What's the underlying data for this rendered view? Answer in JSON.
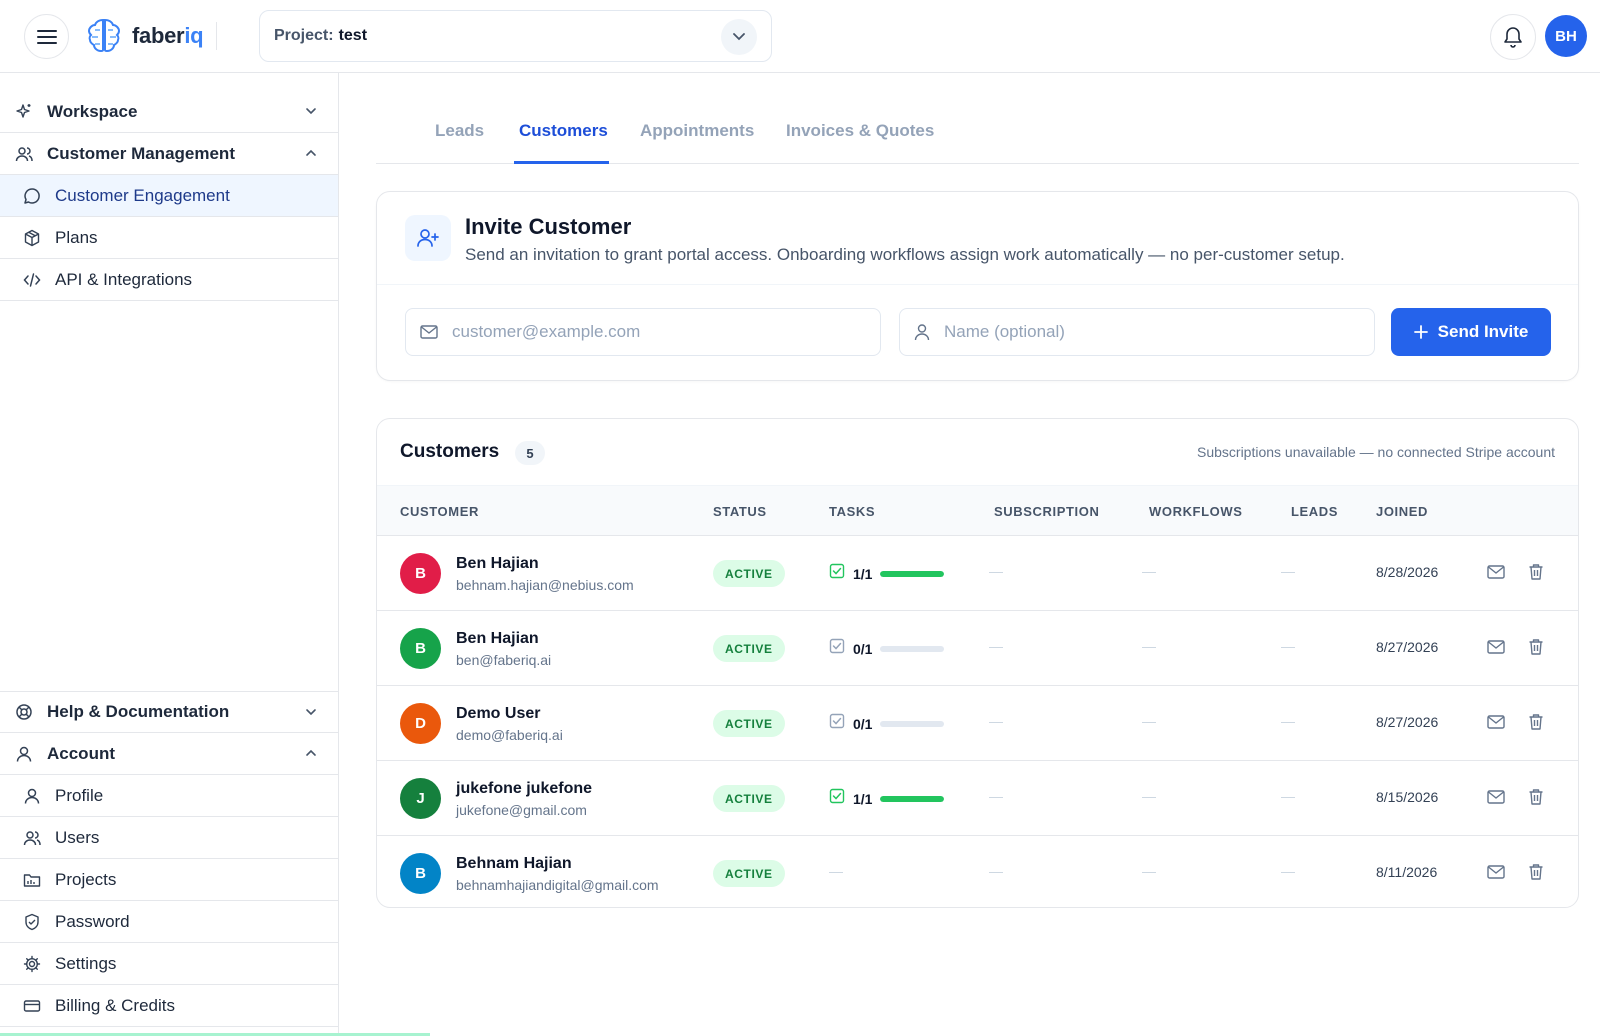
{
  "header": {
    "logo_text_main": "faber",
    "logo_text_accent": "iq",
    "project_label": "Project:",
    "project_value": "test",
    "user_initials": "BH"
  },
  "sidebar": {
    "workspace": "Workspace",
    "customer_management": "Customer Management",
    "items": [
      "Customer Engagement",
      "Plans",
      "API & Integrations"
    ],
    "help": "Help & Documentation",
    "account": "Account",
    "account_items": [
      "Profile",
      "Users",
      "Projects",
      "Password",
      "Settings",
      "Billing & Credits"
    ]
  },
  "tabs": [
    "Leads",
    "Customers",
    "Appointments",
    "Invoices & Quotes"
  ],
  "invite": {
    "title": "Invite Customer",
    "description": "Send an invitation to grant portal access. Onboarding workflows assign work automatically — no per-customer setup.",
    "email_placeholder": "customer@example.com",
    "name_placeholder": "Name (optional)",
    "send_label": "Send Invite"
  },
  "customers": {
    "title": "Customers",
    "count": "5",
    "note": "Subscriptions unavailable — no connected Stripe account",
    "columns": [
      "CUSTOMER",
      "STATUS",
      "TASKS",
      "SUBSCRIPTION",
      "WORKFLOWS",
      "LEADS",
      "JOINED"
    ],
    "rows": [
      {
        "initial": "B",
        "name": "Ben Hajian",
        "email": "behnam.hajian@nebius.com",
        "status": "ACTIVE",
        "tasks": "1/1",
        "task_progress": 1.0,
        "has_tasks": true,
        "subscription": "—",
        "workflows": "—",
        "leads": "—",
        "joined": "8/28/2026",
        "color": "#e11d48"
      },
      {
        "initial": "B",
        "name": "Ben Hajian",
        "email": "ben@faberiq.ai",
        "status": "ACTIVE",
        "tasks": "0/1",
        "task_progress": 0.0,
        "has_tasks": true,
        "subscription": "—",
        "workflows": "—",
        "leads": "—",
        "joined": "8/27/2026",
        "color": "#16a34a"
      },
      {
        "initial": "D",
        "name": "Demo User",
        "email": "demo@faberiq.ai",
        "status": "ACTIVE",
        "tasks": "0/1",
        "task_progress": 0.0,
        "has_tasks": true,
        "subscription": "—",
        "workflows": "—",
        "leads": "—",
        "joined": "8/27/2026",
        "color": "#ea580c"
      },
      {
        "initial": "J",
        "name": "jukefone jukefone",
        "email": "jukefone@gmail.com",
        "status": "ACTIVE",
        "tasks": "1/1",
        "task_progress": 1.0,
        "has_tasks": true,
        "subscription": "—",
        "workflows": "—",
        "leads": "—",
        "joined": "8/15/2026",
        "color": "#15803d"
      },
      {
        "initial": "B",
        "name": "Behnam Hajian",
        "email": "behnamhajiandigital@gmail.com",
        "status": "ACTIVE",
        "tasks": "—",
        "task_progress": 0.0,
        "has_tasks": false,
        "subscription": "—",
        "workflows": "—",
        "leads": "—",
        "joined": "8/11/2026",
        "color": "#0284c7"
      }
    ]
  },
  "colors": {
    "accent": "#2563eb",
    "active_badge_bg": "#dcfce7",
    "active_badge_text": "#15803d",
    "progress": "#22c55e"
  }
}
